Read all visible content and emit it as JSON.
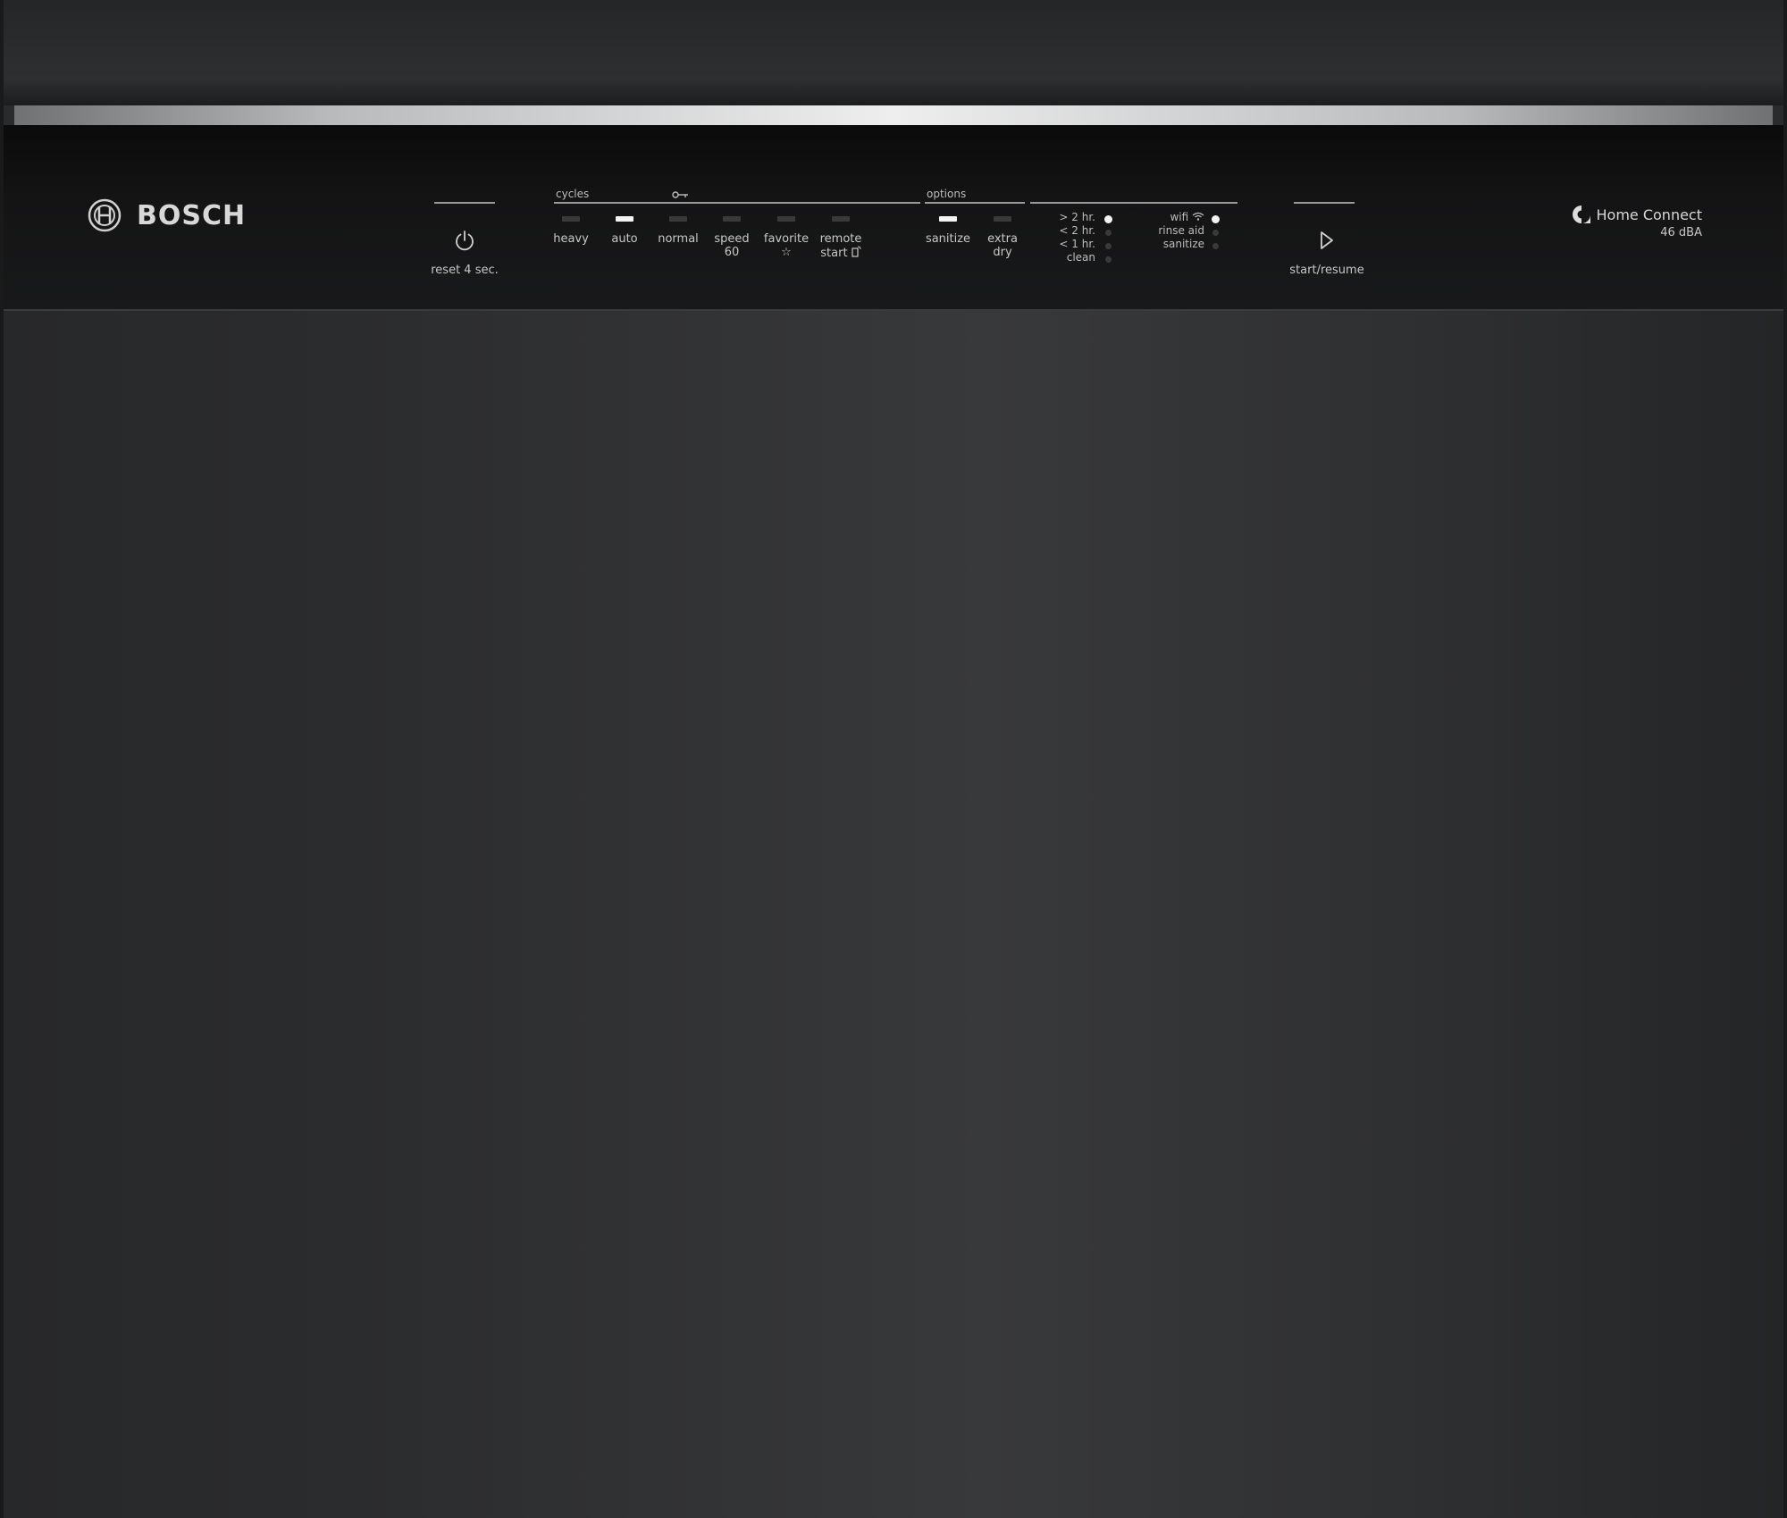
{
  "brand": {
    "name": "BOSCH",
    "icon": "bosch-armature-logo"
  },
  "power": {
    "label": "reset 4 sec.",
    "icon": "power-icon"
  },
  "cycles": {
    "group_label": "cycles",
    "lock_icon": "key-icon",
    "buttons": [
      {
        "line1": "heavy",
        "line2": "",
        "active": false
      },
      {
        "line1": "auto",
        "line2": "",
        "active": true
      },
      {
        "line1": "normal",
        "line2": "",
        "active": false
      },
      {
        "line1": "speed",
        "line2": "60",
        "active": false
      },
      {
        "line1": "favorite",
        "line2": "☆",
        "active": false
      },
      {
        "line1": "remote",
        "line2": "start",
        "active": false
      }
    ]
  },
  "options": {
    "group_label": "options",
    "buttons": [
      {
        "line1": "sanitize",
        "line2": "",
        "active": true
      },
      {
        "line1": "extra",
        "line2": "dry",
        "active": false
      }
    ]
  },
  "time_remaining": {
    "rows": [
      {
        "label": "> 2 hr.",
        "active": true
      },
      {
        "label": "< 2 hr.",
        "active": false
      },
      {
        "label": "< 1 hr.",
        "active": false
      },
      {
        "label": "clean",
        "active": false
      }
    ]
  },
  "status": {
    "rows": [
      {
        "label": "wifi",
        "icon": "wifi-icon",
        "active": true
      },
      {
        "label": "rinse aid",
        "active": false
      },
      {
        "label": "sanitize",
        "active": false
      }
    ]
  },
  "start": {
    "label": "start/resume",
    "icon": "play-icon"
  },
  "home_connect": {
    "name": "Home Connect",
    "noise": "46 dBA",
    "icon": "home-connect-icon"
  },
  "colors": {
    "panel": "#141415",
    "door": "#2f3032",
    "indicator_on": "#f4f4f4",
    "indicator_off": "#3a3a3b"
  }
}
